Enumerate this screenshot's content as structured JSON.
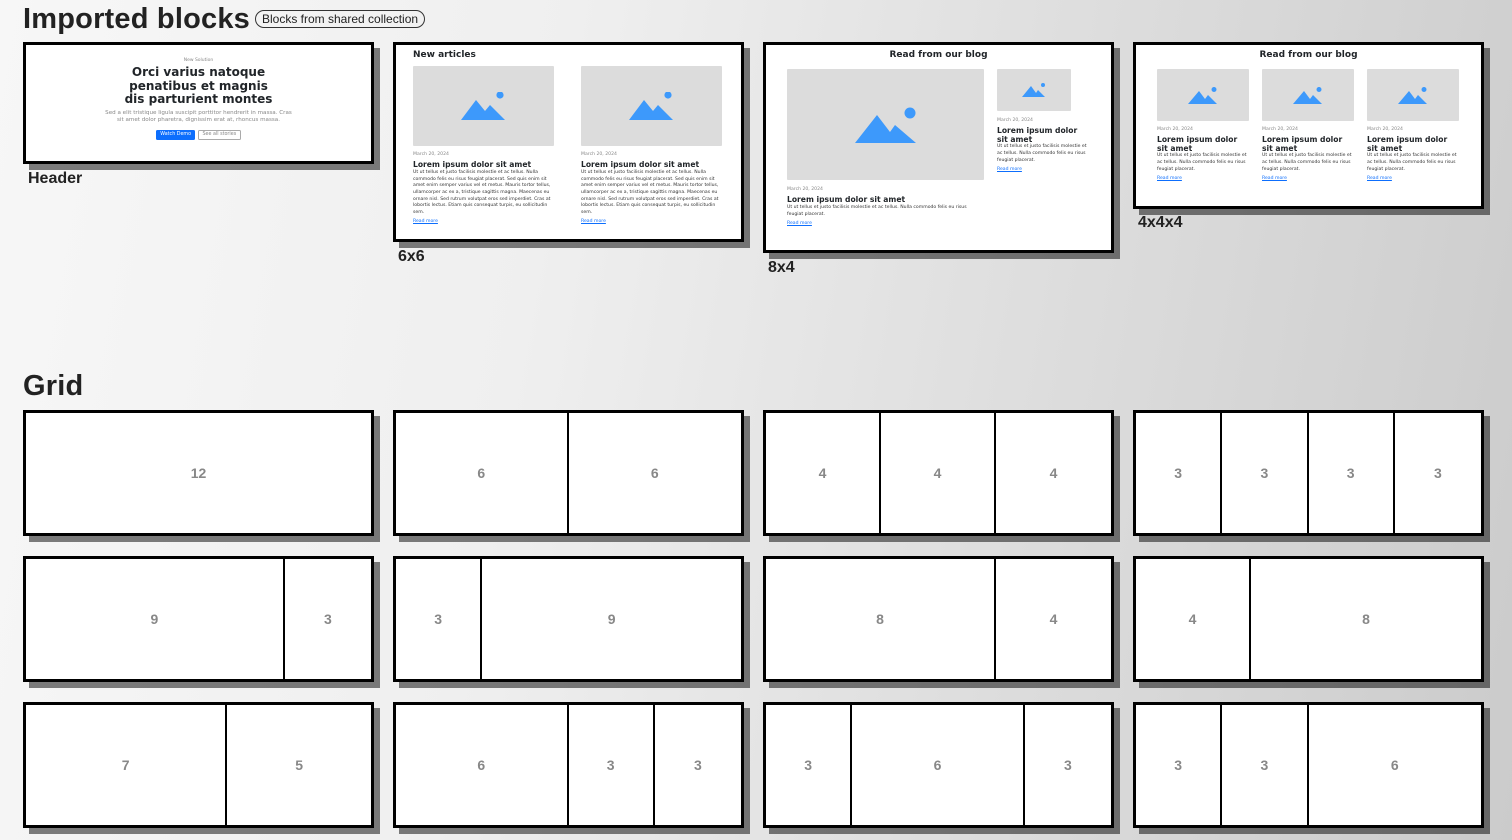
{
  "imported": {
    "title": "Imported blocks",
    "badge": "Blocks from shared collection",
    "blocks": {
      "header": {
        "label": "Header",
        "eyebrow": "New Solution",
        "title": "Orci varius natoque penatibus et magnis dis parturient montes",
        "subtitle": "Sed a elit tristique ligula suscipit porttitor hendrerit in massa. Cras sit amet dolor pharetra, dignissim erat at, rhoncus massa.",
        "primary_button": "Watch Demo",
        "secondary_button": "See all stories"
      },
      "six_six": {
        "label": "6x6",
        "heading": "New articles",
        "articles": [
          {
            "date": "March 20, 2024",
            "title": "Lorem ipsum dolor sit amet",
            "body": "Ut ut tellus et justo facilisis molestie et ac tellus. Nulla commodo felis eu risus feugiat placerat. Sed quis enim sit amet enim semper varius vel et metus. Mauris tortor tellus, ullamcorper ac ex a, tristique sagittis magna. Maecenas eu ornare nisl. Sed rutrum volutpat eros sed imperdiet. Cras at lobortis lectus. Etiam quis consequat turpis, eu sollicitudin sem.",
            "link": "Read more"
          },
          {
            "date": "March 20, 2024",
            "title": "Lorem ipsum dolor sit amet",
            "body": "Ut ut tellus et justo facilisis molestie et ac tellus. Nulla commodo felis eu risus feugiat placerat. Sed quis enim sit amet enim semper varius vel et metus. Mauris tortor tellus, ullamcorper ac ex a, tristique sagittis magna. Maecenas eu ornare nisl. Sed rutrum volutpat eros sed imperdiet. Cras at lobortis lectus. Etiam quis consequat turpis, eu sollicitudin sem.",
            "link": "Read more"
          }
        ]
      },
      "eight_four": {
        "label": "8x4",
        "heading": "Read from our blog",
        "articles": [
          {
            "date": "March 20, 2024",
            "title": "Lorem ipsum dolor sit amet",
            "body": "Ut ut tellus et justo facilisis molestie et ac tellus. Nulla commodo felis eu risus feugiat placerat.",
            "link": "Read more"
          },
          {
            "date": "March 20, 2024",
            "title": "Lorem ipsum dolor sit amet",
            "body": "Ut ut tellus et justo facilisis molestie et ac tellus. Nulla commodo felis eu risus feugiat placerat.",
            "link": "Read more"
          }
        ]
      },
      "four_four_four": {
        "label": "4x4x4",
        "heading": "Read from our blog",
        "articles": [
          {
            "date": "March 20, 2024",
            "title": "Lorem ipsum dolor sit amet",
            "body": "Ut ut tellus et justo facilisis molestie et ac tellus. Nulla commodo felis eu risus feugiat placerat.",
            "link": "Read more"
          },
          {
            "date": "March 20, 2024",
            "title": "Lorem ipsum dolor sit amet",
            "body": "Ut ut tellus et justo facilisis molestie et ac tellus. Nulla commodo felis eu risus feugiat placerat.",
            "link": "Read more"
          },
          {
            "date": "March 20, 2024",
            "title": "Lorem ipsum dolor sit amet",
            "body": "Ut ut tellus et justo facilisis molestie et ac tellus. Nulla commodo felis eu risus feugiat placerat.",
            "link": "Read more"
          }
        ]
      }
    }
  },
  "grid": {
    "title": "Grid",
    "layouts": [
      [
        12
      ],
      [
        6,
        6
      ],
      [
        4,
        4,
        4
      ],
      [
        3,
        3,
        3,
        3
      ],
      [
        9,
        3
      ],
      [
        3,
        9
      ],
      [
        8,
        4
      ],
      [
        4,
        8
      ],
      [
        7,
        5
      ],
      [
        6,
        3,
        3
      ],
      [
        3,
        6,
        3
      ],
      [
        3,
        3,
        6
      ]
    ]
  },
  "colors": {
    "image_icon": "#3d99fb",
    "image_placeholder": "#dcdcdc",
    "primary_button": "#0d6efd",
    "link": "#0d6efd",
    "grid_number": "#888888"
  }
}
